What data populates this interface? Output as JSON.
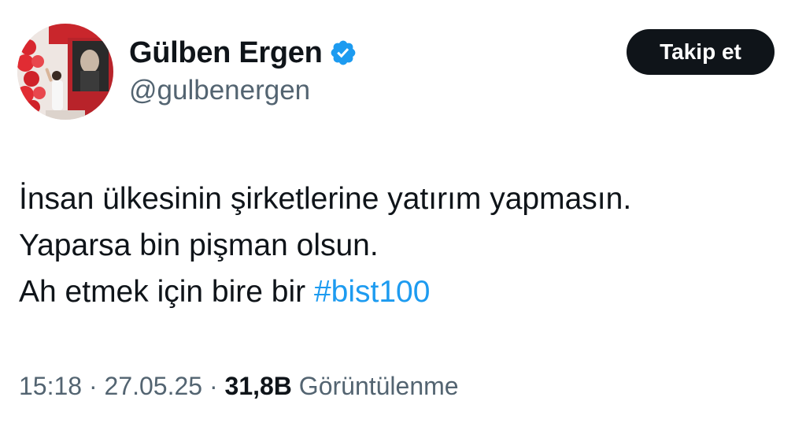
{
  "user": {
    "display_name": "Gülben Ergen",
    "handle": "@gulbenergen",
    "verified": true,
    "verified_color": "#1d9bf0",
    "avatar_icon": "profile-photo"
  },
  "follow_button": {
    "label": "Takip et"
  },
  "tweet": {
    "line1": "İnsan ülkesinin şirketlerine yatırım yapmasın.",
    "line2": "Yaparsa bin pişman olsun.",
    "line3_text": "Ah etmek için bire bir ",
    "hashtag": "#bist100",
    "hashtag_color": "#1d9bf0"
  },
  "meta": {
    "time": "15:18",
    "separator": " · ",
    "date": "27.05.25",
    "views_count": "31,8B",
    "views_label": "Görüntülenme"
  }
}
